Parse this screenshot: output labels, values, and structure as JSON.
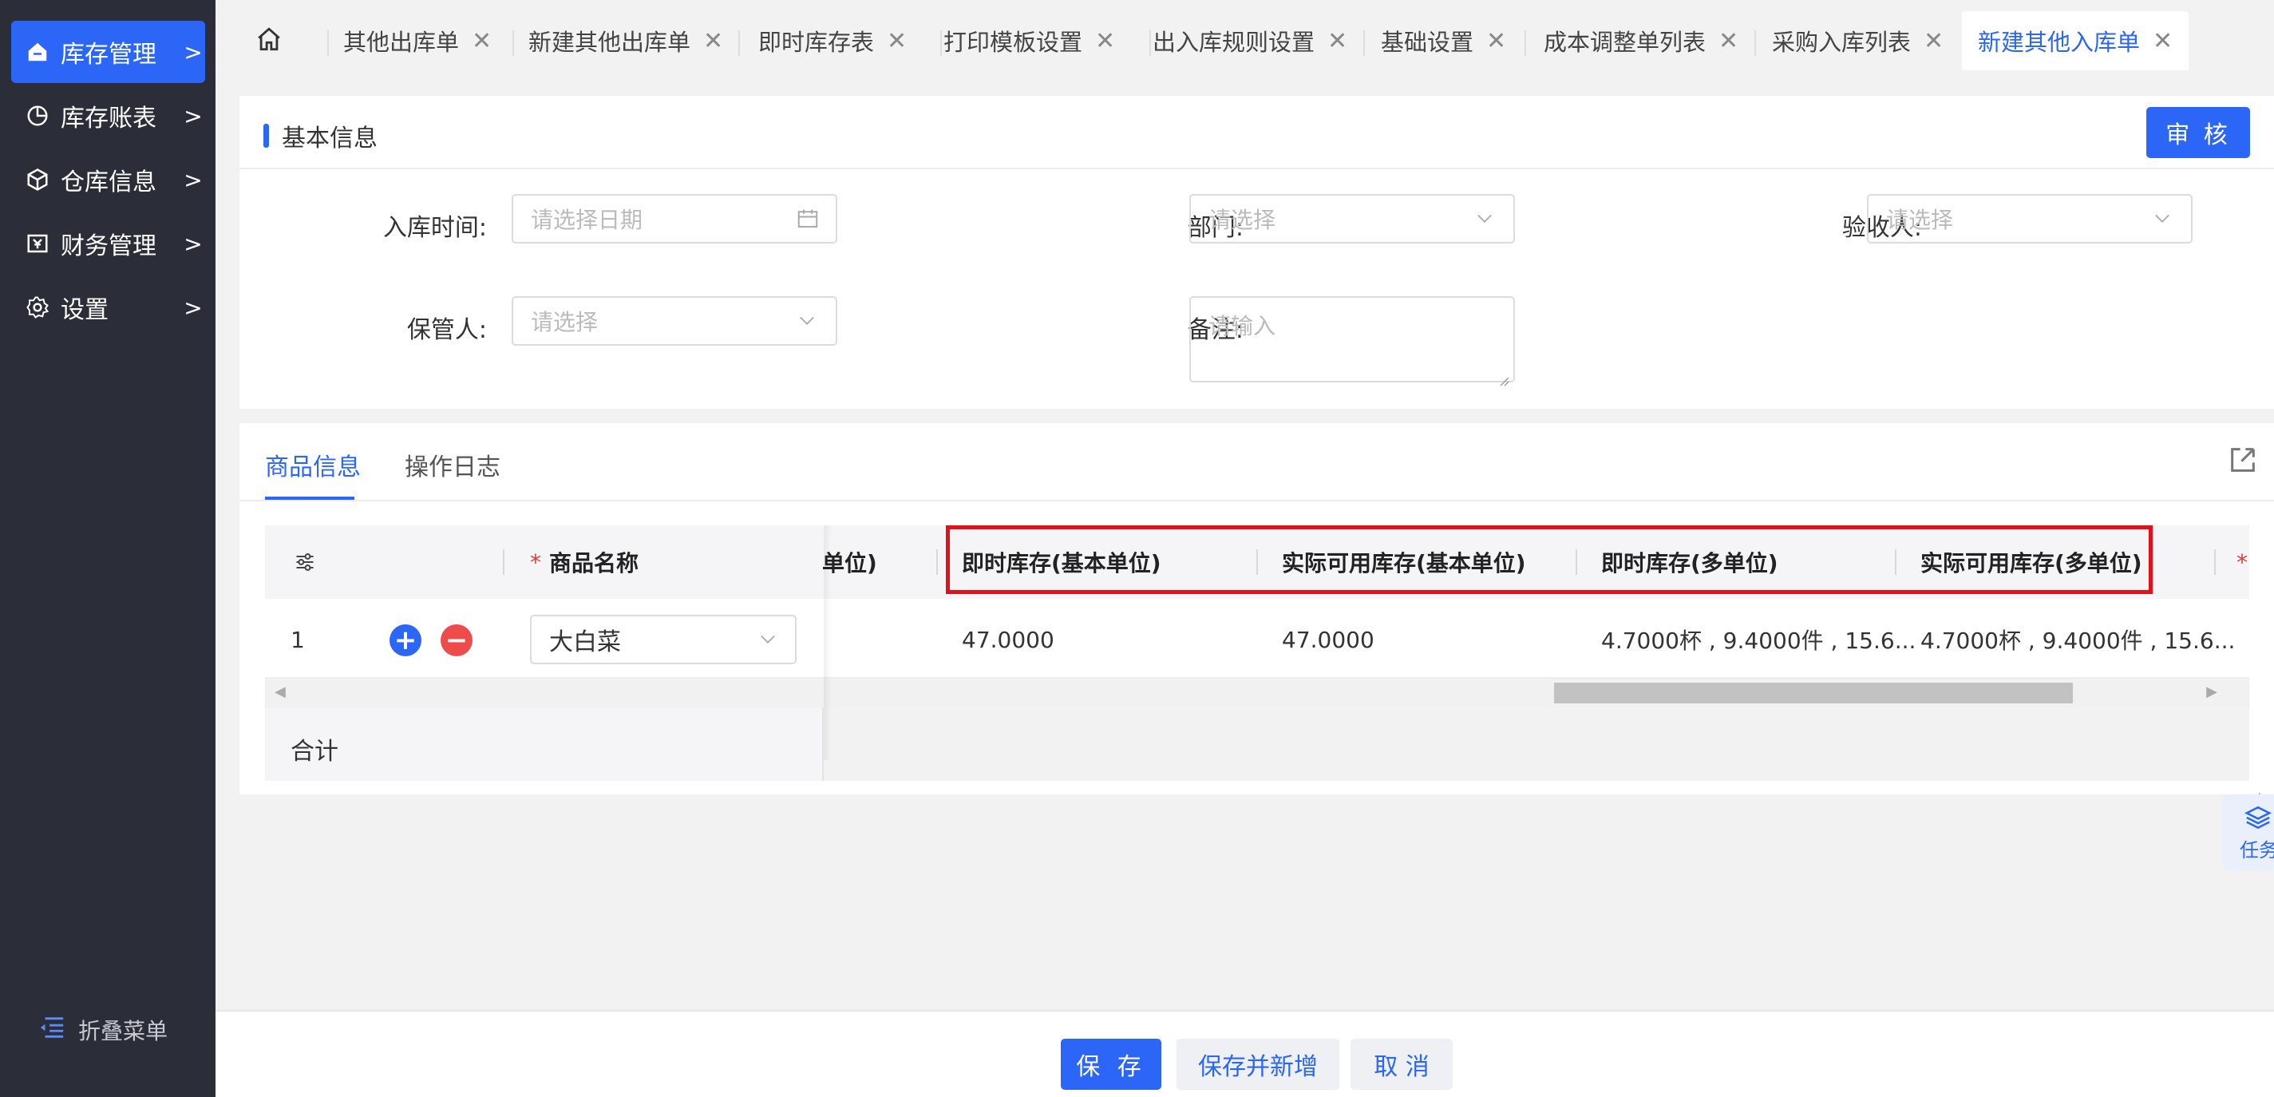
{
  "sidebar": {
    "items": [
      {
        "label": "库存管理",
        "icon": "home-icon",
        "active": true
      },
      {
        "label": "库存账表",
        "icon": "pie-chart-icon",
        "active": false
      },
      {
        "label": "仓库信息",
        "icon": "cube-icon",
        "active": false
      },
      {
        "label": "财务管理",
        "icon": "yen-doc-icon",
        "active": false
      },
      {
        "label": "设置",
        "icon": "gear-icon",
        "active": false
      }
    ],
    "collapse_label": "折叠菜单"
  },
  "tabs": [
    {
      "label": "其他出库单"
    },
    {
      "label": "新建其他出库单"
    },
    {
      "label": "即时库存表"
    },
    {
      "label": "打印模板设置"
    },
    {
      "label": "出入库规则设置"
    },
    {
      "label": "基础设置"
    },
    {
      "label": "成本调整单列表"
    },
    {
      "label": "采购入库列表"
    },
    {
      "label": "新建其他入库单",
      "active": true
    }
  ],
  "basic_info": {
    "title": "基本信息",
    "audit_button": "审 核",
    "fields": {
      "inbound_time": {
        "label": "入库时间:",
        "placeholder": "请选择日期"
      },
      "department": {
        "label": "部门:",
        "placeholder": "请选择"
      },
      "inspector": {
        "label": "验收人:",
        "placeholder": "请选择"
      },
      "keeper": {
        "label": "保管人:",
        "placeholder": "请选择"
      },
      "remark": {
        "label": "备注:",
        "placeholder": "请输入"
      }
    }
  },
  "product": {
    "tabs": [
      "商品信息",
      "操作日志"
    ],
    "columns": {
      "settings_icon": "sliders-icon",
      "product_name": "商品名称",
      "partial_unit": "单位)",
      "instant_stock_base": "即时库存(基本单位)",
      "available_stock_base": "实际可用库存(基本单位)",
      "instant_stock_multi": "即时库存(多单位)",
      "available_stock_multi": "实际可用库存(多单位)",
      "next_required": "*"
    },
    "rows": [
      {
        "index": "1",
        "product_name": "大白菜",
        "instant_stock_base": "47.0000",
        "available_stock_base": "47.0000",
        "instant_stock_multi": "4.7000杯 , 9.4000件 , 15.6...",
        "available_stock_multi": "4.7000杯 , 9.4000件 , 15.6..."
      }
    ],
    "total_label": "合计"
  },
  "task_widget": {
    "label": "任务",
    "icon": "layers-icon"
  },
  "footer": {
    "save": "保 存",
    "save_and_new": "保存并新增",
    "cancel": "取 消"
  },
  "colors": {
    "primary": "#2b66f6",
    "sidebar": "#2b2e38",
    "danger": "#ee4b4b",
    "highlight": "#e0111b"
  }
}
